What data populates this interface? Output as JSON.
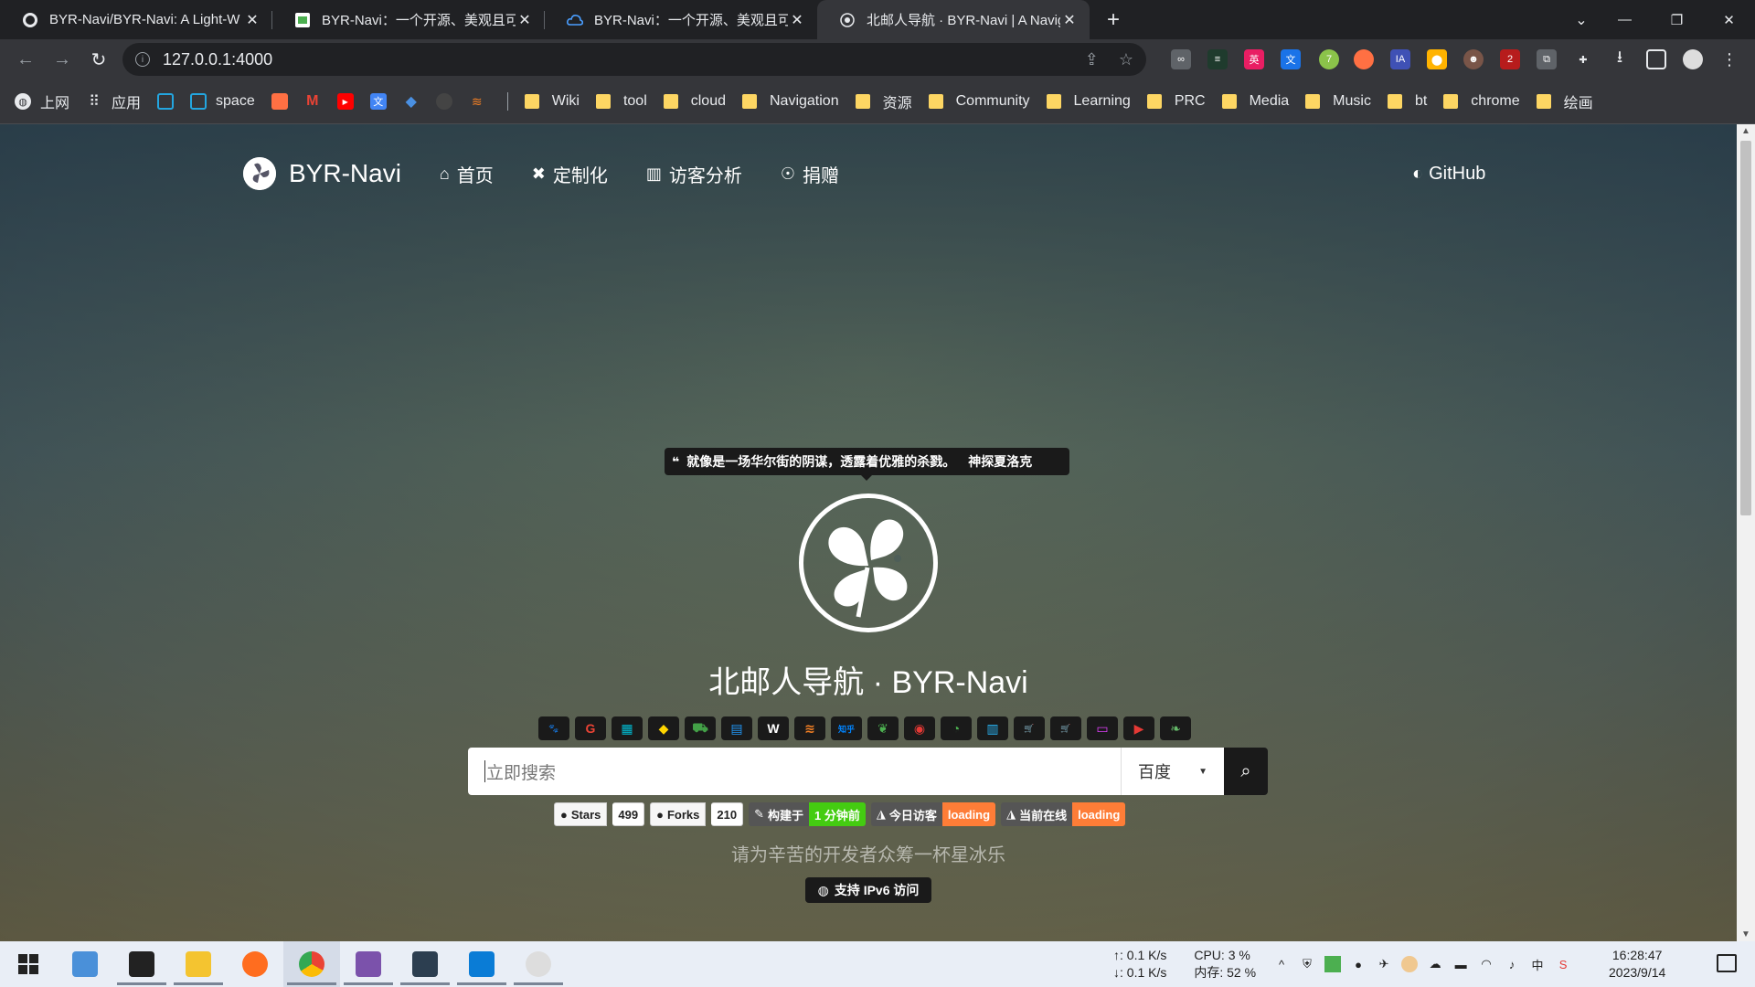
{
  "browser": {
    "tabs": [
      {
        "title": "BYR-Navi/BYR-Navi: A Light-W",
        "icon": "github-icon"
      },
      {
        "title": "BYR-Navi：一个开源、美观且可",
        "icon": "page-icon"
      },
      {
        "title": "BYR-Navi：一个开源、美观且可",
        "icon": "cloud-icon"
      },
      {
        "title": "北邮人导航 · BYR-Navi | A Navig",
        "icon": "github-icon",
        "active": true
      }
    ],
    "url": "127.0.0.1:4000",
    "bookmarks": [
      {
        "label": "上网",
        "icon": "globe-icon"
      },
      {
        "label": "应用",
        "icon": "apps-grid-icon"
      },
      {
        "label": "",
        "icon": "bilibili-icon"
      },
      {
        "label": "space",
        "icon": "bilibili-space-icon"
      },
      {
        "label": "",
        "icon": "app-icon"
      },
      {
        "label": "",
        "icon": "gmail-icon"
      },
      {
        "label": "",
        "icon": "youtube-icon"
      },
      {
        "label": "",
        "icon": "translate-icon"
      },
      {
        "label": "",
        "icon": "diamond-icon"
      },
      {
        "label": "",
        "icon": "github-icon"
      },
      {
        "label": "",
        "icon": "stackoverflow-icon"
      }
    ],
    "folders": [
      "Wiki",
      "tool",
      "cloud",
      "Navigation",
      "资源",
      "Community",
      "Learning",
      "PRC",
      "Media",
      "Music",
      "bt",
      "chrome",
      "绘画"
    ]
  },
  "site": {
    "brand": "BYR-Navi",
    "nav": [
      {
        "label": "首页",
        "icon": "home-icon"
      },
      {
        "label": "定制化",
        "icon": "tools-icon"
      },
      {
        "label": "访客分析",
        "icon": "chart-icon"
      },
      {
        "label": "捐赠",
        "icon": "donate-icon"
      }
    ],
    "github": "GitHub",
    "quote": "就像是一场华尔街的阴谋，透露着优雅的杀戮。",
    "quote_author": "神探夏洛克",
    "title": "北邮人导航 · BYR-Navi",
    "engines": [
      {
        "glyph": "🐾",
        "color": "#2979ff",
        "name": "baidu"
      },
      {
        "glyph": "G",
        "color": "#ea4335",
        "name": "google"
      },
      {
        "glyph": "▦",
        "color": "#00bcd4",
        "name": "bing"
      },
      {
        "glyph": "◆",
        "color": "#ffd600",
        "name": "sogou"
      },
      {
        "glyph": "⛟",
        "color": "#43a047",
        "name": "360"
      },
      {
        "glyph": "▤",
        "color": "#2196f3",
        "name": "byr"
      },
      {
        "glyph": "W",
        "color": "#ffffff",
        "name": "wikipedia"
      },
      {
        "glyph": "≋",
        "color": "#f48024",
        "name": "stackoverflow"
      },
      {
        "glyph": "知乎",
        "color": "#0084ff",
        "name": "zhihu"
      },
      {
        "glyph": "❦",
        "color": "#4caf50",
        "name": "douban"
      },
      {
        "glyph": "◉",
        "color": "#e53935",
        "name": "weibo"
      },
      {
        "glyph": "◔",
        "color": "#4caf50",
        "name": "wechat"
      },
      {
        "glyph": "▥",
        "color": "#29b6f6",
        "name": "book"
      },
      {
        "glyph": "🛒",
        "color": "#ff9800",
        "name": "taobao"
      },
      {
        "glyph": "🛒",
        "color": "#e53935",
        "name": "jd"
      },
      {
        "glyph": "▭",
        "color": "#e040fb",
        "name": "tv"
      },
      {
        "glyph": "▶",
        "color": "#e53935",
        "name": "youtube"
      },
      {
        "glyph": "❧",
        "color": "#66bb6a",
        "name": "leaf"
      }
    ],
    "search_placeholder": "立即搜索",
    "engine_selected": "百度",
    "badges": {
      "stars_label": "Stars",
      "stars_value": "499",
      "forks_label": "Forks",
      "forks_value": "210",
      "built_label": "构建于",
      "built_value": "1 分钟前",
      "today_label": "今日访客",
      "today_value": "loading",
      "online_label": "当前在线",
      "online_value": "loading"
    },
    "donate_text": "请为辛苦的开发者众筹一杯星冰乐",
    "ipv6_text": "支持 IPv6 访问"
  },
  "taskbar": {
    "net_up": "↑: 0.1 K/s",
    "net_down": "↓: 0.1 K/s",
    "cpu": "CPU: 3 %",
    "mem": "内存: 52 %",
    "ime": "中",
    "time": "16:28:47",
    "date": "2023/9/14"
  }
}
